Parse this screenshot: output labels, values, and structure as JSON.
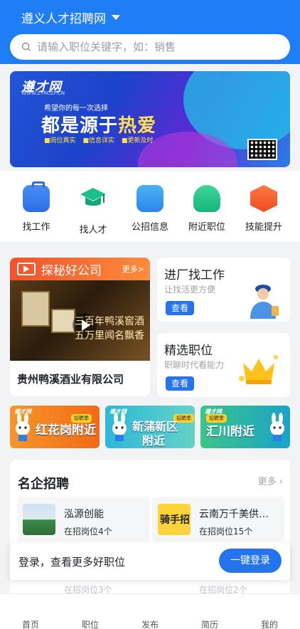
{
  "header": {
    "city": "遵义人才招聘网",
    "search_placeholder": "请输入职位关键字，如：销售"
  },
  "banner": {
    "logo": "遵才网",
    "logo_sub": "WWW.ZYRCZP.CN",
    "subtitle": "希望你的每一次选择",
    "headline_a": "都是源于",
    "headline_b": "热爱",
    "tags": [
      "■岗位真实",
      "■信息详实",
      "■更新及时"
    ]
  },
  "quick_links": [
    {
      "label": "找工作",
      "icon": "briefcase-icon"
    },
    {
      "label": "找人才",
      "icon": "graduation-cap-icon"
    },
    {
      "label": "公招信息",
      "icon": "document-icon"
    },
    {
      "label": "附近职位",
      "icon": "location-person-icon"
    },
    {
      "label": "技能提升",
      "icon": "skill-hexagon-icon"
    }
  ],
  "featured": {
    "title": "探秘好公司",
    "more": "更多>",
    "video_caption_line1": "三百年鸭溪窖酒",
    "video_caption_line2": "五万里闻名飘香",
    "company": "贵州鸭溪酒业有限公司"
  },
  "cards": [
    {
      "title": "进厂找工作",
      "subtitle": "让找活更方便",
      "button": "查看"
    },
    {
      "title": "精选职位",
      "subtitle": "职聊时代看能力",
      "button": "查看"
    }
  ],
  "areas": [
    {
      "logo": "遵才网",
      "tag": "招聘季",
      "text": "红花岗附近"
    },
    {
      "logo": "遵才网",
      "tag": "招聘季",
      "text_line1": "新蒲新区",
      "text_line2": "附近"
    },
    {
      "logo": "遵才网",
      "tag": "招聘季",
      "text": "汇川附近"
    }
  ],
  "famous": {
    "title": "名企招聘",
    "more": "更多",
    "companies": [
      {
        "name": "泓源创能",
        "count": "在招岗位4个"
      },
      {
        "name": "云南万千美供…",
        "count": "在招岗位15个",
        "logo_text": "骑手招"
      }
    ],
    "peek_counts": [
      "在招岗位3个",
      "在招岗位2个"
    ]
  },
  "login_bar": {
    "text": "登录，查看更多好职位",
    "button": "一键登录"
  },
  "tabbar": [
    "首页",
    "职位",
    "发布",
    "简历",
    "我的"
  ],
  "colors": {
    "primary": "#1f7ef5",
    "button": "#2474ef",
    "accent_orange": "#f4512c"
  }
}
